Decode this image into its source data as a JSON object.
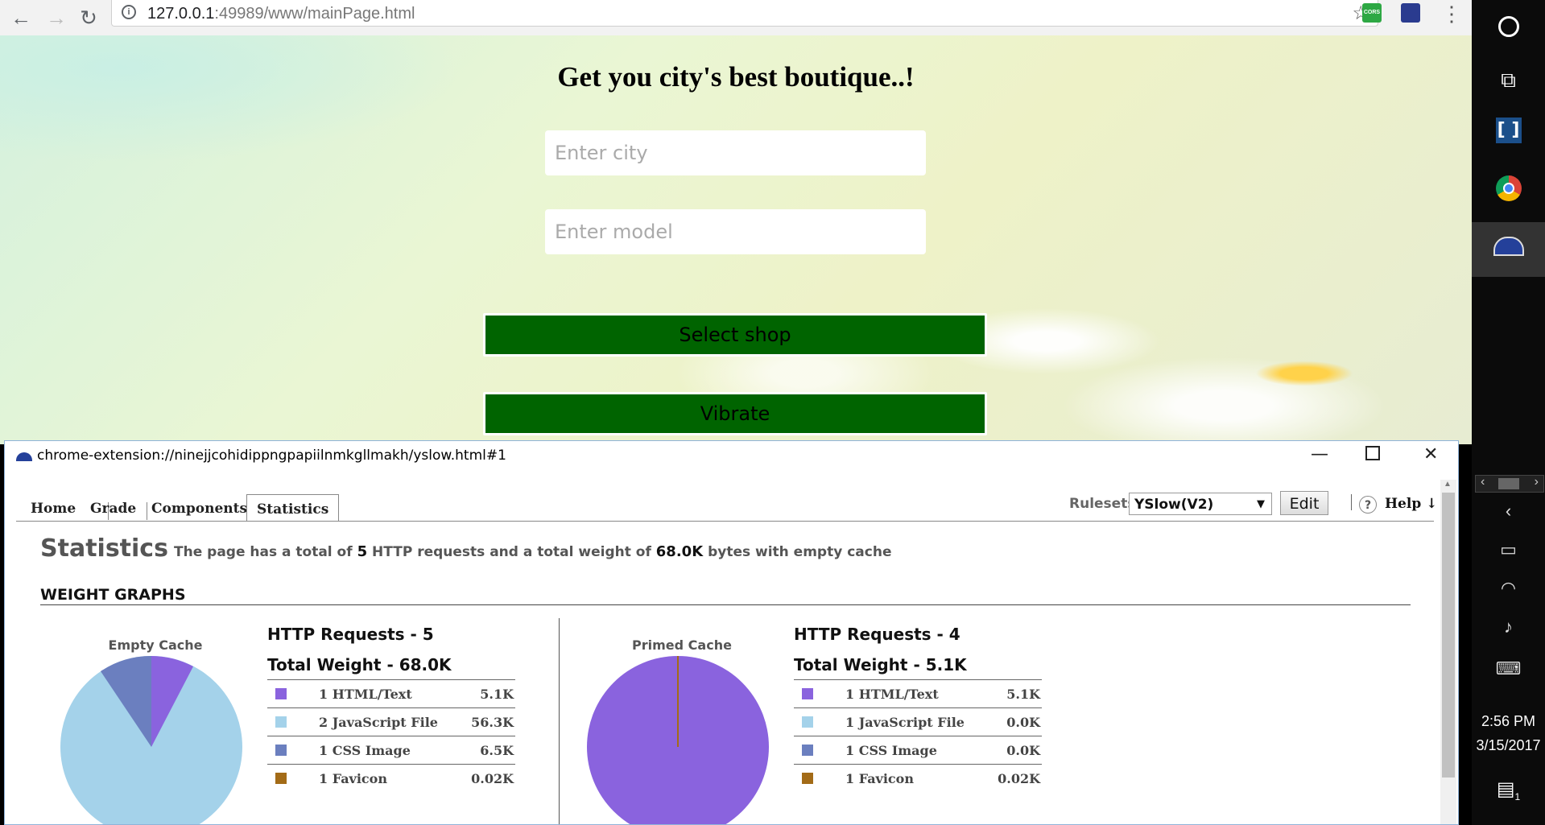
{
  "browser": {
    "url_host": "127.0.0.1",
    "url_rest": ":49989/www/mainPage.html",
    "ext_cors_label": "CORS"
  },
  "webpage": {
    "title": "Get you city's best boutique..!",
    "city_placeholder": "Enter city",
    "model_placeholder": "Enter model",
    "select_shop_label": "Select shop",
    "vibrate_label": "Vibrate"
  },
  "popup": {
    "title": "chrome-extension://ninejjcohidippngpapiilnmkgllmakh/yslow.html#1",
    "tabs": [
      {
        "label": "Home"
      },
      {
        "label": "Grade"
      },
      {
        "label": "Components"
      },
      {
        "label": "Statistics",
        "active": true
      }
    ],
    "rulesets_label": "Rulesets",
    "ruleset_value": "YSlow(V2)",
    "edit_label": "Edit",
    "help_icon": "?",
    "help_label": "Help ↓",
    "stats_title": "Statistics",
    "summary": {
      "prefix": "The page has a total of",
      "requests": "5",
      "middle": "HTTP requests and a total weight of",
      "weight": "68.0K",
      "suffix": "bytes with empty cache"
    },
    "weight_graphs_title": "WEIGHT GRAPHS",
    "empty_cache": {
      "label": "Empty Cache",
      "requests": "HTTP Requests - 5",
      "weight": "Total Weight - 68.0K",
      "rows": [
        {
          "name": "1 HTML/Text",
          "value": "5.1K",
          "color": "#8a63de"
        },
        {
          "name": "2 JavaScript File",
          "value": "56.3K",
          "color": "#a4d2ea"
        },
        {
          "name": "1 CSS Image",
          "value": "6.5K",
          "color": "#6b7fbf"
        },
        {
          "name": "1 Favicon",
          "value": "0.02K",
          "color": "#a36b17"
        }
      ]
    },
    "primed_cache": {
      "label": "Primed Cache",
      "requests": "HTTP Requests - 4",
      "weight": "Total Weight - 5.1K",
      "rows": [
        {
          "name": "1 HTML/Text",
          "value": "5.1K",
          "color": "#8a63de"
        },
        {
          "name": "1 JavaScript File",
          "value": "0.0K",
          "color": "#a4d2ea"
        },
        {
          "name": "1 CSS Image",
          "value": "0.0K",
          "color": "#6b7fbf"
        },
        {
          "name": "1 Favicon",
          "value": "0.02K",
          "color": "#a36b17"
        }
      ]
    }
  },
  "taskbar": {
    "time": "2:56 PM",
    "date": "3/15/2017",
    "notif_count": "1"
  }
}
